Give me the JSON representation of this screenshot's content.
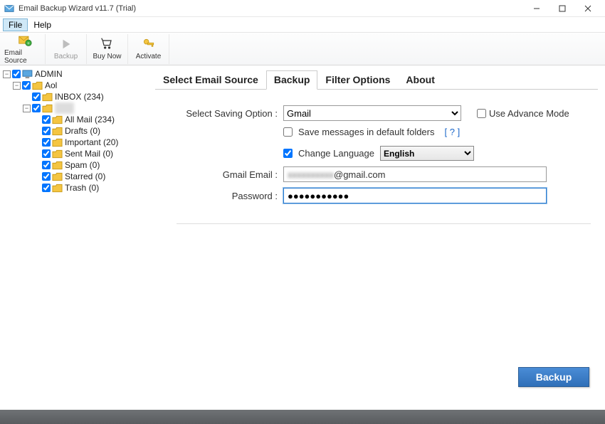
{
  "window": {
    "title": "Email Backup Wizard v11.7 (Trial)"
  },
  "menu": {
    "file": "File",
    "help": "Help"
  },
  "toolbar": {
    "email_source": "Email Source",
    "backup": "Backup",
    "buy_now": "Buy Now",
    "activate": "Activate"
  },
  "tree": {
    "root": "ADMIN",
    "account": "Aol",
    "inbox": "INBOX (234)",
    "folders": [
      "All Mail (234)",
      "Drafts (0)",
      "Important (20)",
      "Sent Mail (0)",
      "Spam (0)",
      "Starred (0)",
      "Trash (0)"
    ]
  },
  "tabs": {
    "select_source": "Select Email Source",
    "backup": "Backup",
    "filter": "Filter Options",
    "about": "About"
  },
  "panel": {
    "saving_label": "Select Saving Option :",
    "saving_value": "Gmail",
    "advance_label": "Use Advance Mode",
    "save_default_label": "Save messages in default folders",
    "help_link": "[ ? ]",
    "change_lang_label": "Change Language",
    "lang_value": "English",
    "email_label": "Gmail Email :",
    "email_value": "@gmail.com",
    "password_label": "Password :",
    "password_value": "●●●●●●●●●●●",
    "backup_button": "Backup"
  }
}
